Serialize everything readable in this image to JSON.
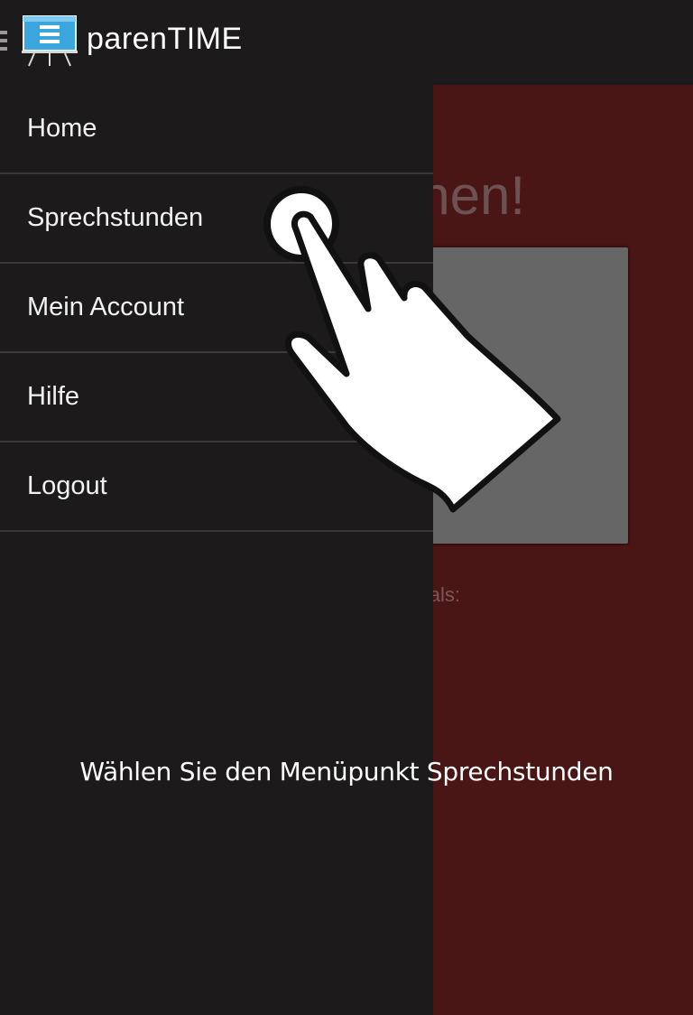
{
  "actionbar": {
    "title": "parenTIME",
    "menu_icon": "hamburger-icon",
    "logo_icon": "presentation-board-icon",
    "logo_color": "#3aa6dd"
  },
  "content": {
    "heading_partial": "hen!",
    "caption_partial": "als:",
    "background_color": "#4a1515"
  },
  "drawer": {
    "items": [
      {
        "label": "Home"
      },
      {
        "label": "Sprechstunden"
      },
      {
        "label": "Mein Account"
      },
      {
        "label": "Hilfe"
      },
      {
        "label": "Logout"
      }
    ]
  },
  "tutorial": {
    "instruction": "Wählen Sie den Menüpunkt Sprechstunden",
    "pointer_icon": "tap-hand-icon"
  }
}
